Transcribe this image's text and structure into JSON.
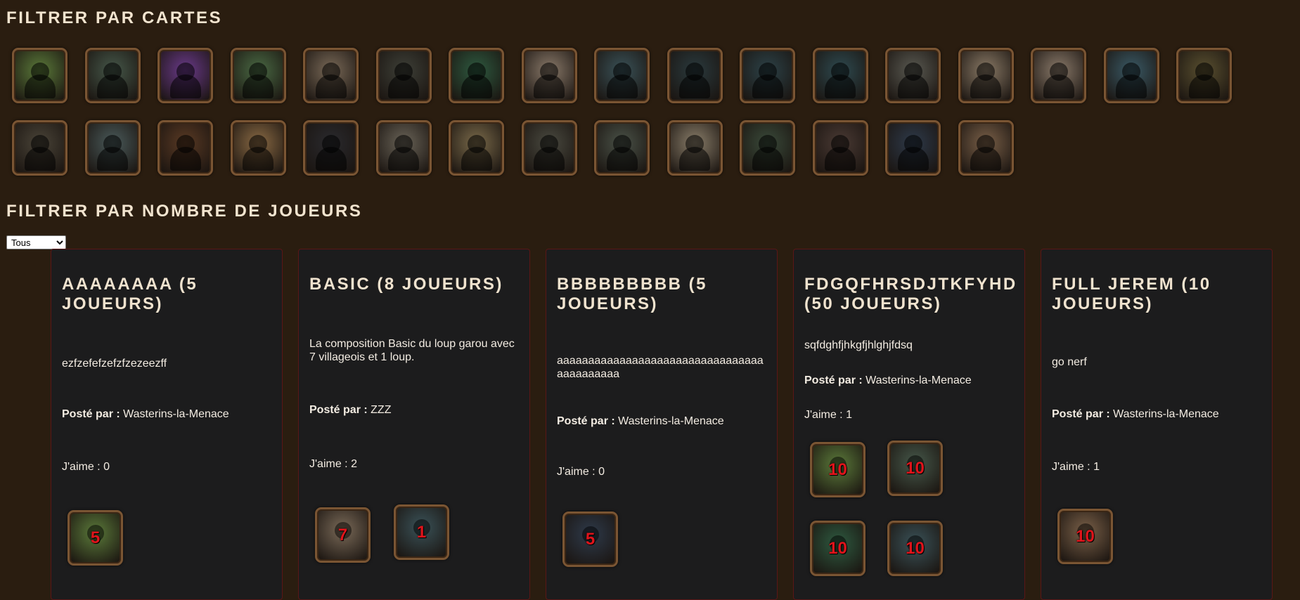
{
  "filter_cards": {
    "title": "Filtrer par cartes",
    "cards": [
      {
        "name": "fox-card",
        "color": "#5b7a3a"
      },
      {
        "name": "villagers-trio-card",
        "color": "#46584a"
      },
      {
        "name": "seer-card",
        "color": "#6a3a8a"
      },
      {
        "name": "witch-cauldron-card",
        "color": "#4a6a44"
      },
      {
        "name": "villager-card",
        "color": "#7a6a58"
      },
      {
        "name": "hooded-figure-card",
        "color": "#3e4038"
      },
      {
        "name": "piper-card",
        "color": "#2e5a40"
      },
      {
        "name": "cupid-card",
        "color": "#8a7a6a"
      },
      {
        "name": "werewolf-moon-card",
        "color": "#3a5258"
      },
      {
        "name": "wild-child-card",
        "color": "#2a3a3e"
      },
      {
        "name": "wolf-moon-card",
        "color": "#2c4248"
      },
      {
        "name": "big-bad-wolf-card",
        "color": "#2e4a50"
      },
      {
        "name": "knight-card",
        "color": "#5a5a52"
      },
      {
        "name": "angel-card",
        "color": "#8a7a66"
      },
      {
        "name": "servant-card",
        "color": "#8a7a6a"
      },
      {
        "name": "white-werewolf-card",
        "color": "#3a5a66"
      },
      {
        "name": "little-girl-card",
        "color": "#5a5030"
      },
      {
        "name": "hunter-card",
        "color": "#4a4438"
      },
      {
        "name": "wolfdog-card",
        "color": "#4a5a5a"
      },
      {
        "name": "pyromaniac-card",
        "color": "#5a3a24"
      },
      {
        "name": "old-man-card",
        "color": "#8a6a44"
      },
      {
        "name": "raven-hood-card",
        "color": "#2a2a2e"
      },
      {
        "name": "two-sisters-card",
        "color": "#6a6458"
      },
      {
        "name": "minstrel-card",
        "color": "#7a6a4a"
      },
      {
        "name": "elder-card",
        "color": "#4a4a40"
      },
      {
        "name": "masked-figure-card",
        "color": "#4a5248"
      },
      {
        "name": "priest-light-card",
        "color": "#8a7e6a"
      },
      {
        "name": "crow-card",
        "color": "#3a4a3a"
      },
      {
        "name": "sorceress-card",
        "color": "#4a3a34"
      },
      {
        "name": "judge-throne-card",
        "color": "#2e3a4a"
      },
      {
        "name": "bear-tamer-card",
        "color": "#7a6048"
      }
    ]
  },
  "filter_players": {
    "title": "Filtrer par nombre de joueurs",
    "selected": "Tous"
  },
  "compositions": [
    {
      "title": "aaaaaaaa (5 joueurs)",
      "description": "ezfzefefzefzfzezeezff",
      "posted_by_label": "Posté par :",
      "author": "Wasterins-la-Menace",
      "likes": "J'aime : 0",
      "cards": [
        {
          "count": "5",
          "color": "#5b7a3a"
        }
      ]
    },
    {
      "title": "Basic (8 joueurs)",
      "description": "La composition Basic du loup garou avec 7 villageois et 1 loup.",
      "posted_by_label": "Posté par :",
      "author": "ZZZ",
      "likes": "J'aime : 2",
      "cards": [
        {
          "count": "7",
          "color": "#7a6a58"
        },
        {
          "count": "1",
          "color": "#3a5258"
        }
      ]
    },
    {
      "title": "bbbbbbbbb (5 joueurs)",
      "description": "aaaaaaaaaaaaaaaaaaaaaaaaaaaaaaaaaaaaaaaaaaa",
      "posted_by_label": "Posté par :",
      "author": "Wasterins-la-Menace",
      "likes": "J'aime : 0",
      "cards": [
        {
          "count": "5",
          "color": "#2e3a4a"
        }
      ]
    },
    {
      "title": "fdgqfhrsdjtkfyhd (50 joueurs)",
      "description": "sqfdghfjhkgfjhlghjfdsq",
      "posted_by_label": "Posté par :",
      "author": "Wasterins-la-Menace",
      "likes": "J'aime : 1",
      "cards": [
        {
          "count": "10",
          "color": "#5b7a3a"
        },
        {
          "count": "10",
          "color": "#46584a"
        },
        {
          "count": "10",
          "color": "#2e5a40"
        },
        {
          "count": "10",
          "color": "#3a5258"
        }
      ]
    },
    {
      "title": "full jerem (10 joueurs)",
      "description": "go nerf",
      "posted_by_label": "Posté par :",
      "author": "Wasterins-la-Menace",
      "likes": "J'aime : 1",
      "cards": [
        {
          "count": "10",
          "color": "#7a6048"
        }
      ]
    }
  ]
}
